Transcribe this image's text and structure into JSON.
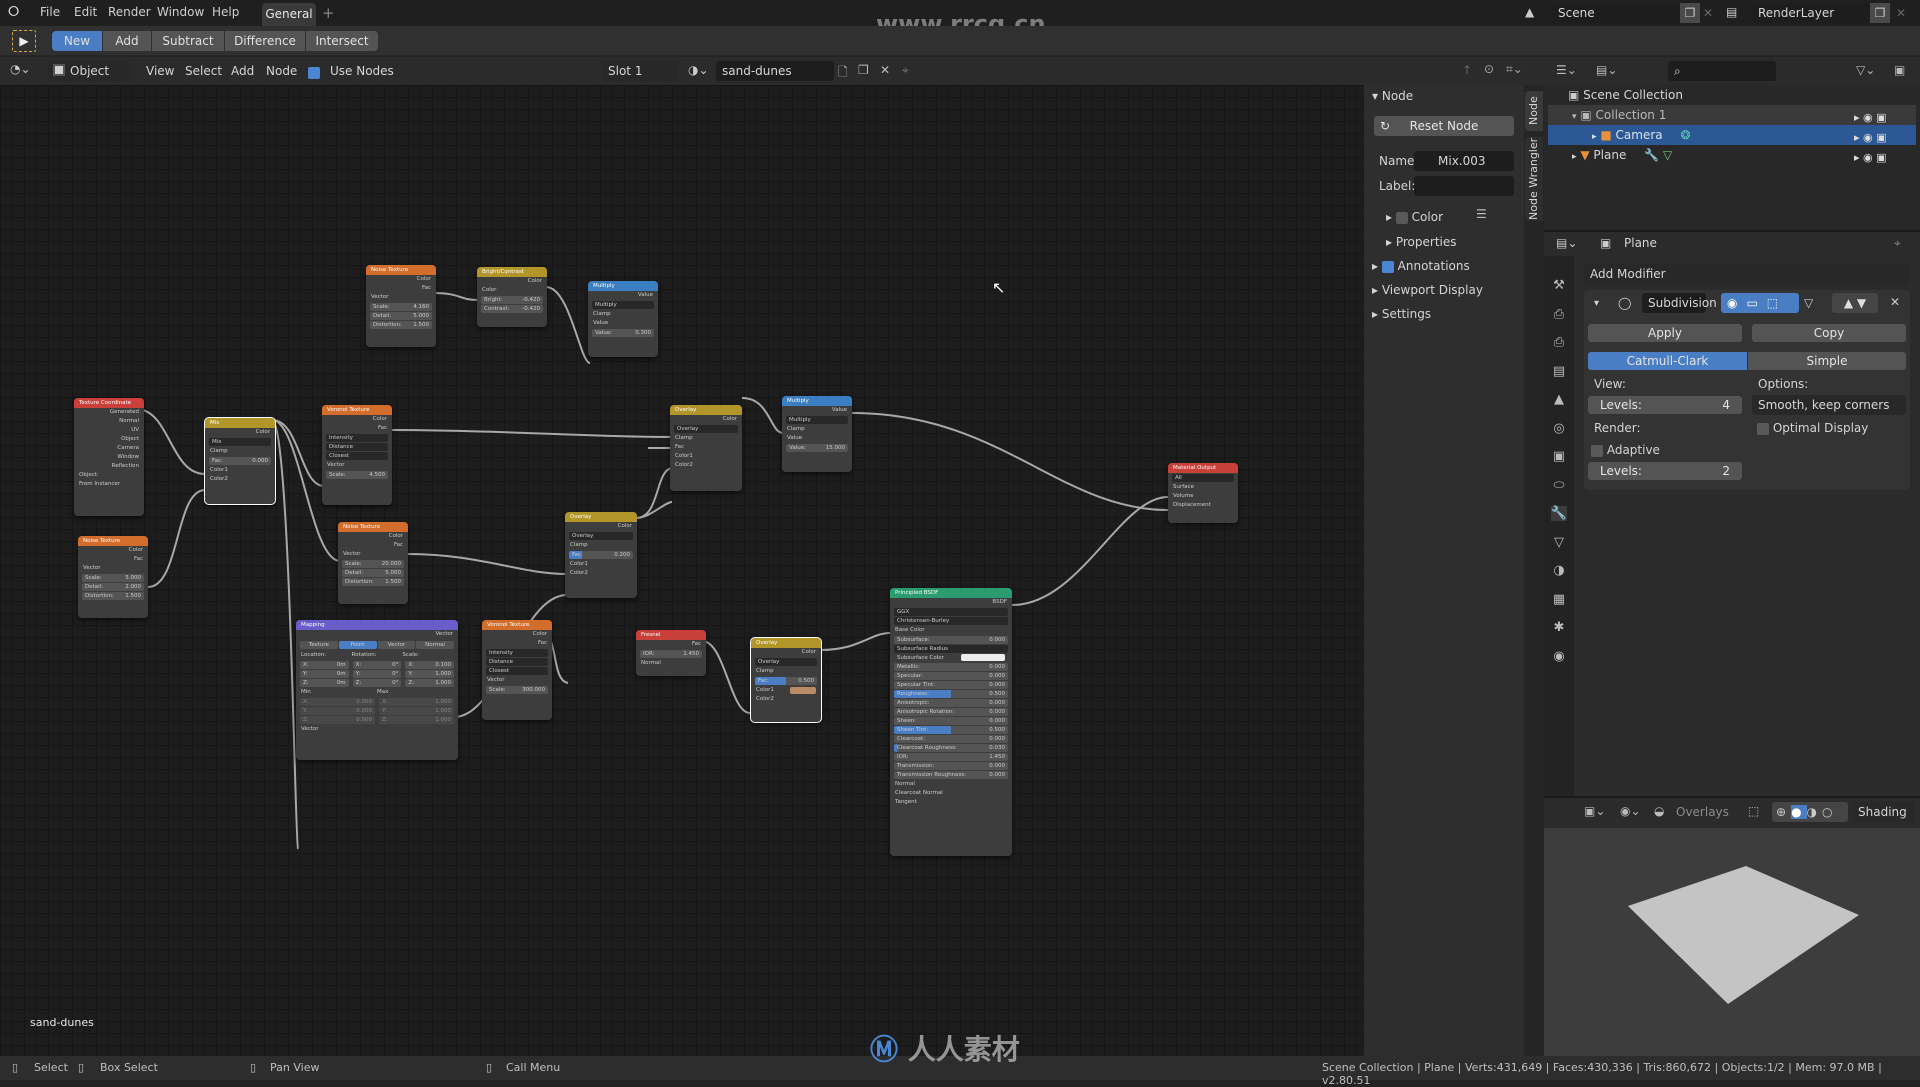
{
  "topbar": {
    "menus": [
      "File",
      "Edit",
      "Render",
      "Window",
      "Help"
    ],
    "workspace_tab": "General",
    "add_tab": "+",
    "scene": "Scene",
    "view_layer": "RenderLayer",
    "watermark": "www.rrcg.cn"
  },
  "toolbar": {
    "modes": [
      "New",
      "Add",
      "Subtract",
      "Difference",
      "Intersect"
    ],
    "active_mode": "New"
  },
  "node_header": {
    "object_type": "Object",
    "menus": [
      "View",
      "Select",
      "Add",
      "Node"
    ],
    "use_nodes_label": "Use Nodes",
    "use_nodes": true,
    "slot": "Slot 1",
    "material": "sand-dunes"
  },
  "editor": {
    "material_label": "sand-dunes",
    "nodes": {
      "tex_coord": {
        "title": "Texture Coordinate",
        "outputs": [
          "Generated",
          "Normal",
          "UV",
          "Object",
          "Camera",
          "Window",
          "Reflection"
        ],
        "object_label": "Object:",
        "from_instancer": "From Instancer"
      },
      "noise1": {
        "title": "Noise Texture",
        "outputs": [
          "Color",
          "Fac"
        ],
        "input": "Vector",
        "fields": [
          [
            "Scale:",
            "5.000"
          ],
          [
            "Detail:",
            "2.000"
          ],
          [
            "Distortion:",
            "1.500"
          ]
        ]
      },
      "mix": {
        "title": "Mix",
        "output": "Color",
        "blend": "Mix",
        "clamp": "Clamp",
        "fac": [
          "Fac:",
          "0.000"
        ],
        "inputs": [
          "Color1",
          "Color2"
        ]
      },
      "noise2": {
        "title": "Noise Texture",
        "outputs": [
          "Color",
          "Fac"
        ],
        "input": "Vector",
        "fields": [
          [
            "Scale:",
            "4.160"
          ],
          [
            "Detail:",
            "5.000"
          ],
          [
            "Distortion:",
            "1.500"
          ]
        ]
      },
      "brightcontrast": {
        "title": "Bright/Contrast",
        "output": "Color",
        "input": "Color",
        "fields": [
          [
            "Bright:",
            "-0.420"
          ],
          [
            "Contrast:",
            "-0.420"
          ]
        ]
      },
      "multiply1": {
        "title": "Multiply",
        "output": "Value",
        "op": "Multiply",
        "clamp": "Clamp",
        "input": "Value",
        "field": [
          "Value:",
          "0.300"
        ]
      },
      "voronoi1": {
        "title": "Voronoi Texture",
        "outputs": [
          "Color",
          "Fac"
        ],
        "dropdowns": [
          "Intensity",
          "Distance",
          "Closest"
        ],
        "input": "Vector",
        "field": [
          "Scale:",
          "4.500"
        ]
      },
      "noise3": {
        "title": "Noise Texture",
        "outputs": [
          "Color",
          "Fac"
        ],
        "input": "Vector",
        "fields": [
          [
            "Scale:",
            "20.000"
          ],
          [
            "Detail:",
            "5.000"
          ],
          [
            "Distortion:",
            "1.500"
          ]
        ]
      },
      "overlay1": {
        "title": "Overlay",
        "output": "Color",
        "blend": "Overlay",
        "clamp": "Clamp",
        "inputs": [
          "Fac",
          "Color1",
          "Color2"
        ]
      },
      "multiply2": {
        "title": "Multiply",
        "output": "Value",
        "op": "Multiply",
        "clamp": "Clamp",
        "input": "Value",
        "field": [
          "Value:",
          "15.000"
        ]
      },
      "overlay2": {
        "title": "Overlay",
        "output": "Color",
        "blend": "Overlay",
        "clamp": "Clamp",
        "fac": [
          "Fac:",
          "0.200"
        ],
        "inputs": [
          "Color1",
          "Color2"
        ]
      },
      "mapping": {
        "title": "Mapping",
        "output": "Vector",
        "types": [
          "Texture",
          "Point",
          "Vector",
          "Normal"
        ],
        "active_type": "Point",
        "headers": [
          "Location:",
          "Rotation:",
          "Scale:"
        ],
        "rows": [
          [
            "X:",
            "0m",
            "X:",
            "0°",
            "X:",
            "0.100"
          ],
          [
            "Y:",
            "0m",
            "Y:",
            "0°",
            "Y:",
            "1.000"
          ],
          [
            "Z:",
            "0m",
            "Z:",
            "0°",
            "Z:",
            "1.000"
          ]
        ],
        "min": "Min",
        "max": "Max",
        "minmax": [
          [
            "X:",
            "0.000",
            "X:",
            "1.000"
          ],
          [
            "Y:",
            "0.000",
            "Y:",
            "1.000"
          ],
          [
            "Z:",
            "0.000",
            "Z:",
            "1.000"
          ]
        ],
        "input": "Vector"
      },
      "voronoi2": {
        "title": "Voronoi Texture",
        "outputs": [
          "Color",
          "Fac"
        ],
        "dropdowns": [
          "Intensity",
          "Distance",
          "Closest"
        ],
        "input": "Vector",
        "field": [
          "Scale:",
          "300.000"
        ]
      },
      "fresnel": {
        "title": "Fresnel",
        "output": "Fac",
        "field": [
          "IOR:",
          "1.450"
        ],
        "input": "Normal"
      },
      "overlay3": {
        "title": "Overlay",
        "output": "Color",
        "blend": "Overlay",
        "clamp": "Clamp",
        "fac": [
          "Fac:",
          "0.500"
        ],
        "inputs": [
          "Color1",
          "Color2"
        ],
        "color1_swatch": "#b98a63"
      },
      "principled": {
        "title": "Principled BSDF",
        "output": "BSDF",
        "distribution": "GGX",
        "subsurface_method": "Christensen-Burley",
        "base_color": "Base Color",
        "fields": [
          [
            "Subsurface:",
            "0.000"
          ],
          [
            "Subsurface Radius",
            ""
          ],
          [
            "Subsurface Color",
            ""
          ],
          [
            "Metallic:",
            "0.000"
          ],
          [
            "Specular:",
            "0.000"
          ],
          [
            "Specular Tint:",
            "0.000"
          ],
          [
            "Roughness:",
            "0.500"
          ],
          [
            "Anisotropic:",
            "0.000"
          ],
          [
            "Anisotropic Rotation:",
            "0.000"
          ],
          [
            "Sheen:",
            "0.000"
          ],
          [
            "Sheen Tint:",
            "0.500"
          ],
          [
            "Clearcoat:",
            "0.000"
          ],
          [
            "Clearcoat Roughness:",
            "0.030"
          ],
          [
            "IOR:",
            "1.450"
          ],
          [
            "Transmission:",
            "0.000"
          ],
          [
            "Transmission Roughness:",
            "0.000"
          ]
        ],
        "vectors": [
          "Normal",
          "Clearcoat Normal",
          "Tangent"
        ]
      },
      "output": {
        "title": "Material Output",
        "target": "All",
        "inputs": [
          "Surface",
          "Volume",
          "Displacement"
        ]
      }
    }
  },
  "npanel": {
    "node_header": "Node",
    "reset_node": "Reset Node",
    "name_label": "Name:",
    "name_value": "Mix.003",
    "label_label": "Label:",
    "label_value": "",
    "color": "Color",
    "properties": "Properties",
    "annotations": "Annotations",
    "viewport_display": "Viewport Display",
    "settings": "Settings",
    "tabs": [
      "Node",
      "Node Wrangler"
    ]
  },
  "outliner": {
    "scene_collection": "Scene Collection",
    "collection": "Collection 1",
    "camera": "Camera",
    "plane": "Plane"
  },
  "properties": {
    "object": "Plane",
    "add_modifier": "Add Modifier",
    "modifier_name": "Subdivision",
    "apply": "Apply",
    "copy": "Copy",
    "catmull": "Catmull-Clark",
    "simple": "Simple",
    "view_label": "View:",
    "view_levels_label": "Levels:",
    "view_levels": "4",
    "options_label": "Options:",
    "uv_smooth": "Smooth, keep corners",
    "render_label": "Render:",
    "optimal_display": "Optimal Display",
    "adaptive": "Adaptive",
    "render_levels_label": "Levels:",
    "render_levels": "2"
  },
  "viewport": {
    "overlays": "Overlays",
    "shading": "Shading"
  },
  "statusbar": {
    "select": "Select",
    "box_select": "Box Select",
    "pan_view": "Pan View",
    "call_menu": "Call Menu",
    "stats": "Scene Collection | Plane | Verts:431,649 | Faces:430,336 | Tris:860,672 | Objects:1/2 | Mem: 97.0 MB | v2.80.51",
    "brand": "人人素材"
  },
  "colors": {
    "accent": "#4a7ec4",
    "selected_row": "#2c5896"
  }
}
